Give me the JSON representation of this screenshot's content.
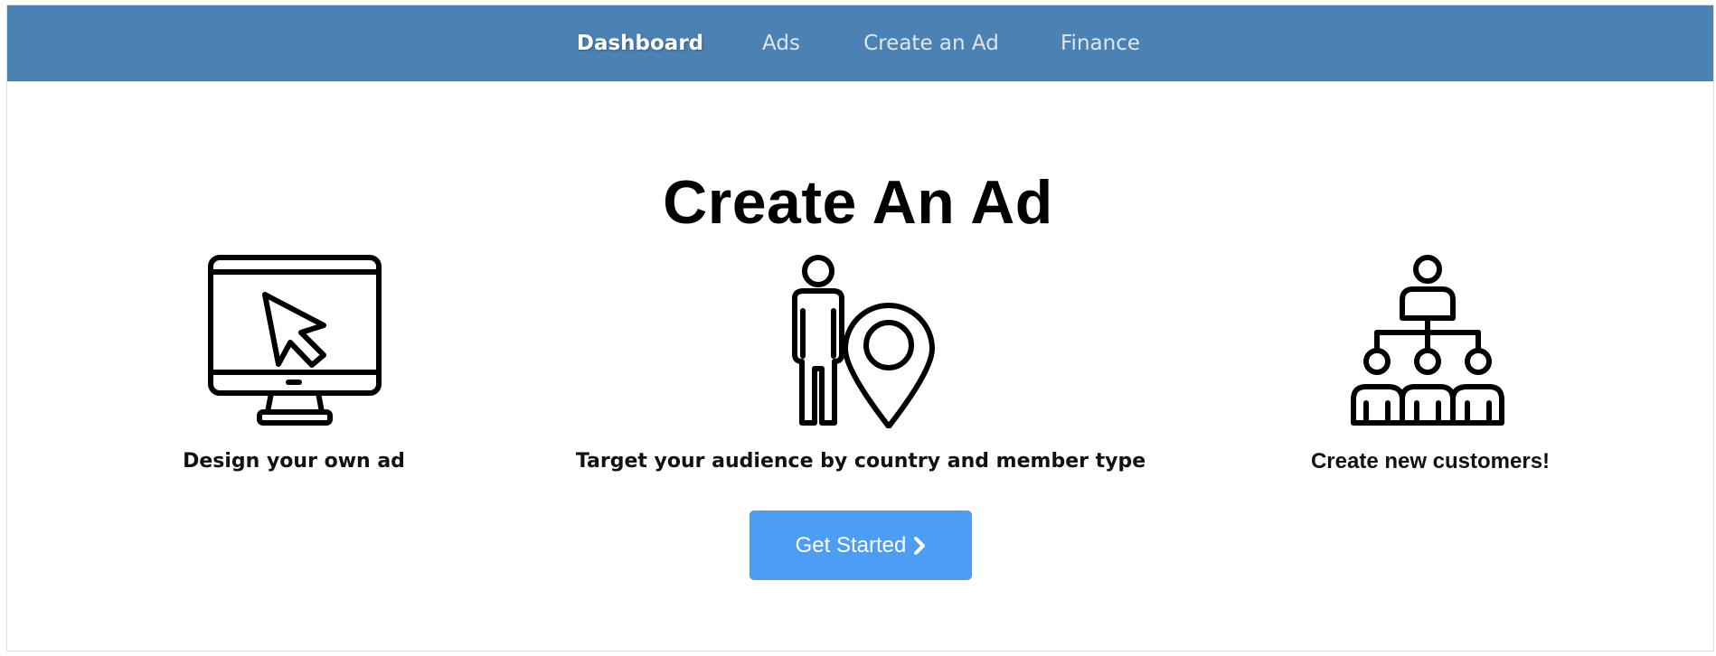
{
  "nav": {
    "items": [
      {
        "label": "Dashboard",
        "active": true
      },
      {
        "label": "Ads",
        "active": false
      },
      {
        "label": "Create an Ad",
        "active": false
      },
      {
        "label": "Finance",
        "active": false
      }
    ]
  },
  "page": {
    "title": "Create An Ad"
  },
  "features": [
    {
      "icon": "monitor-cursor-icon",
      "label": "Design your own ad"
    },
    {
      "icon": "person-location-pin-icon",
      "label": "Target your audience by country and member type"
    },
    {
      "icon": "people-hierarchy-icon",
      "label": "Create new customers!"
    }
  ],
  "cta": {
    "label": "Get Started",
    "icon": "chevron-right-icon"
  },
  "colors": {
    "navbar": "#4c82b3",
    "nav_text": "#dbe6f1",
    "button": "#4c9df3",
    "text": "#111111"
  }
}
